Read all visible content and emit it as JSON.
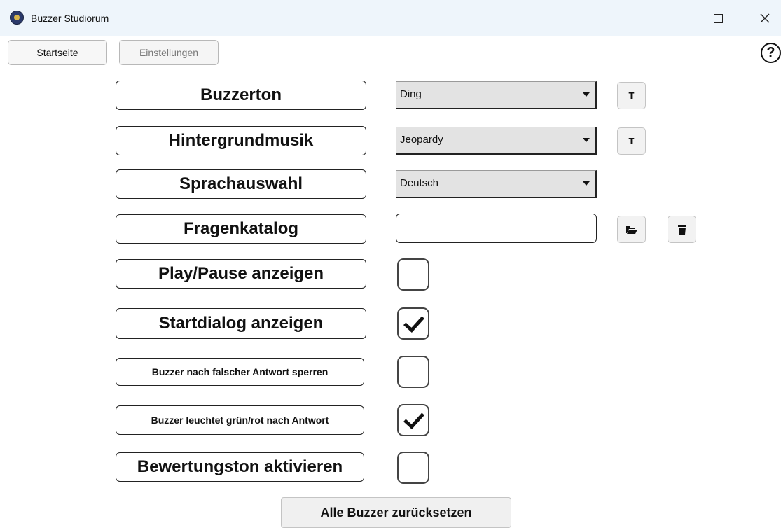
{
  "window": {
    "title": "Buzzer Studiorum",
    "app_icon": "buzzer-logo-icon",
    "minimize_label": "—",
    "maximize_label": "□",
    "close_label": "✕"
  },
  "nav": {
    "start_label": "Startseite",
    "settings_label": "Einstellungen",
    "help_label": "?"
  },
  "settings": {
    "buzzerton": {
      "label": "Buzzerton",
      "value": "Ding",
      "test_label": "T"
    },
    "hintergrundmusik": {
      "label": "Hintergrundmusik",
      "value": "Jeopardy",
      "test_label": "T"
    },
    "sprachauswahl": {
      "label": "Sprachauswahl",
      "value": "Deutsch"
    },
    "fragenkatalog": {
      "label": "Fragenkatalog",
      "value": "",
      "open_icon": "folder-open-icon",
      "delete_icon": "trash-icon"
    },
    "play_pause": {
      "label": "Play/Pause anzeigen",
      "checked": false
    },
    "startdialog": {
      "label": "Startdialog anzeigen",
      "checked": true
    },
    "buzzer_sperren": {
      "label": "Buzzer nach falscher Antwort sperren",
      "checked": false
    },
    "buzzer_leuchtet": {
      "label": "Buzzer leuchtet grün/rot nach Antwort",
      "checked": true
    },
    "bewertungston": {
      "label": "Bewertungston aktivieren",
      "checked": false
    }
  },
  "reset_button_label": "Alle Buzzer zurücksetzen"
}
